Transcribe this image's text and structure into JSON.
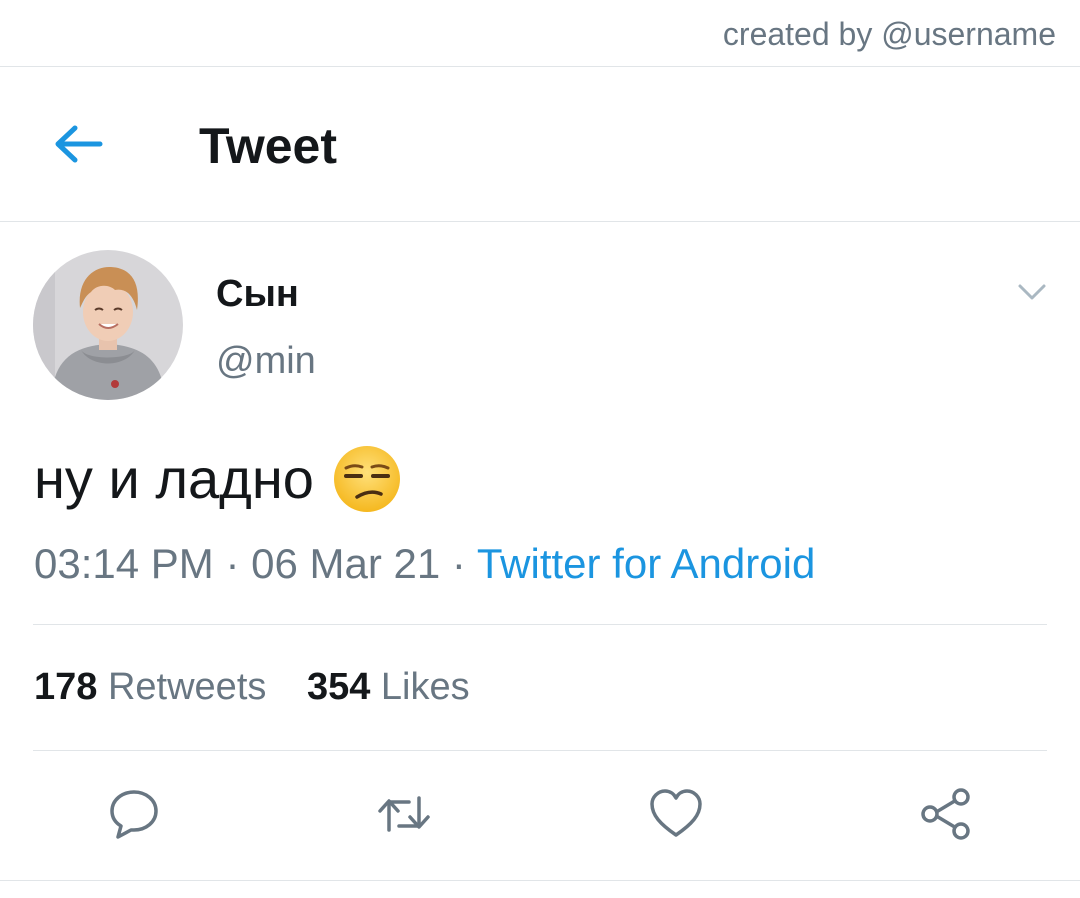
{
  "watermark": {
    "credit": "created by @username"
  },
  "header": {
    "title": "Tweet",
    "back_icon": "arrow-left-icon"
  },
  "tweet": {
    "display_name": "Сын",
    "handle": "@min",
    "text": "ну и ладно",
    "emoji": "unamused-face",
    "time": "03:14 PM",
    "separator": "·",
    "date": "06 Mar 21",
    "source": "Twitter for Android"
  },
  "stats": {
    "retweets_count": "178",
    "retweets_label": "Retweets",
    "likes_count": "354",
    "likes_label": "Likes"
  },
  "actions": [
    "reply-icon",
    "retweet-icon",
    "like-icon",
    "share-icon"
  ],
  "colors": {
    "accent": "#1b95e0",
    "text_primary": "#14171a",
    "text_secondary": "#687682",
    "divider": "#e1e5e8"
  }
}
